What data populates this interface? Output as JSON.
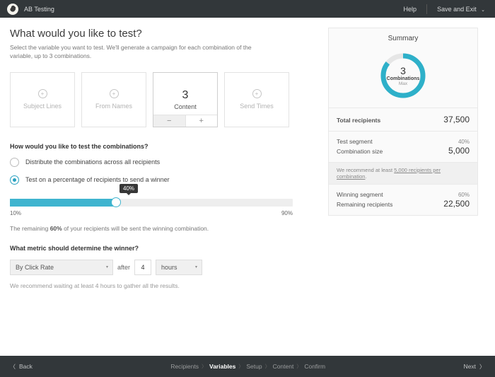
{
  "header": {
    "title": "AB Testing",
    "help": "Help",
    "save": "Save and Exit"
  },
  "page": {
    "h1": "What would you like to test?",
    "sub": "Select the variable you want to test. We'll generate a campaign for each combination of the variable, up to 3 combinations."
  },
  "cards": [
    {
      "label": "Subject Lines"
    },
    {
      "label": "From Names"
    },
    {
      "label": "Content",
      "count": "3"
    },
    {
      "label": "Send Times"
    }
  ],
  "combo": {
    "heading": "How would you like to test the combinations?",
    "opt1": "Distribute the combinations across all recipients",
    "opt2": "Test on a percentage of recipients to send a winner"
  },
  "slider": {
    "tooltip": "40%",
    "min": "10%",
    "max": "90%"
  },
  "remaining_pre": "The remaining ",
  "remaining_pct": "60%",
  "remaining_post": " of your recipients will be sent the winning combination.",
  "metric": {
    "heading": "What metric should determine the winner?",
    "by": "By Click Rate",
    "after": "after",
    "value": "4",
    "unit": "hours",
    "rec": "We recommend waiting at least 4 hours to gather all the results."
  },
  "summary": {
    "title": "Summary",
    "donut_num": "3",
    "donut_lab": "Combinations",
    "donut_sub": "Max",
    "total_k": "Total recipients",
    "total_v": "37,500",
    "test_k": "Test segment",
    "test_v": "40%",
    "comb_k": "Combination size",
    "comb_v": "5,000",
    "rec_pre": "We recommend at least ",
    "rec_u": "5,000 recipients per combination",
    "rec_post": ".",
    "win_k": "Winning segment",
    "win_v": "60%",
    "rem_k": "Remaining recipients",
    "rem_v": "22,500"
  },
  "footer": {
    "back": "Back",
    "steps": [
      "Recipients",
      "Variables",
      "Setup",
      "Content",
      "Confirm"
    ],
    "next": "Next"
  },
  "chart_data": {
    "type": "pie",
    "title": "Combinations",
    "values": [
      86
    ],
    "max": 100,
    "center_value": 3,
    "center_label": "Combinations",
    "center_sub": "Max"
  }
}
